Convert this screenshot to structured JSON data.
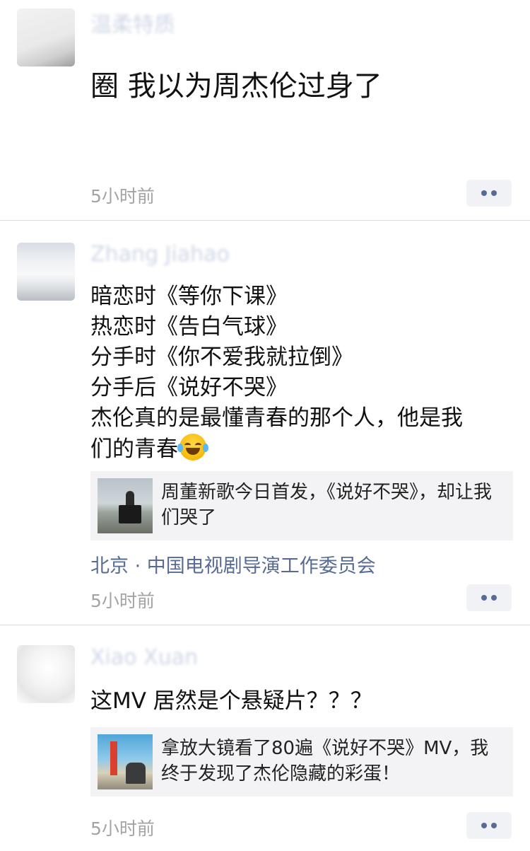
{
  "posts": [
    {
      "author": "温柔特质",
      "lines": [
        "圈 我以为周杰伦过身了"
      ],
      "time": "5小时前"
    },
    {
      "author": "Zhang Jiahao",
      "lines": [
        "暗恋时《等你下课》",
        "热恋时《告白气球》",
        "分手时《你不爱我就拉倒》",
        "分手后《说好不哭》",
        "杰伦真的是最懂青春的那个人，他是我",
        "们的青春"
      ],
      "emoji": "face-with-tears-of-joy",
      "link_card": {
        "text": "周董新歌今日首发，《说好不哭》，却让我们哭了"
      },
      "location": "北京 · 中国电视剧导演工作委员会",
      "time": "5小时前"
    },
    {
      "author": "Xiao Xuan",
      "lines": [
        "这MV 居然是个悬疑片？？？"
      ],
      "link_card": {
        "text": "拿放大镜看了80遍《说好不哭》MV，我终于发现了杰伦隐藏的彩蛋！"
      },
      "time": "5小时前"
    }
  ],
  "colors": {
    "link": "#576b95",
    "time": "#a3a3a3",
    "card_bg": "#f3f3f5"
  }
}
